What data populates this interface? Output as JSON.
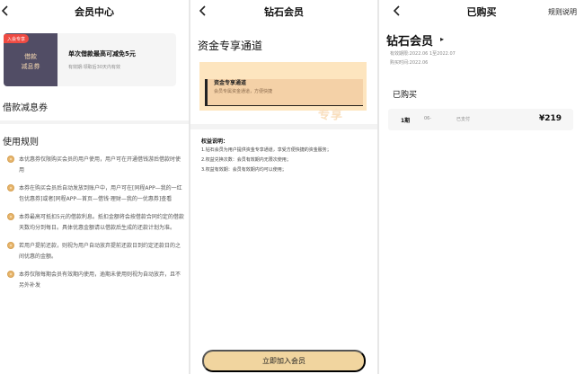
{
  "screens": [
    {
      "title": "会员中心",
      "coupon": {
        "badge": "入会专享",
        "name_line1": "借款",
        "name_line2": "减息券",
        "main": "单次借款最高可减免5元",
        "sub": "有效期:领取后30天内有效"
      },
      "section1": "借款减息券",
      "section2": "使用规则",
      "rules": [
        "本优惠券仅限购买会员的用户使用，用户可在开通借钱游后借款时使用",
        "本券在购买会员后自动发放到账户中，用户可在[同程APP—我的一红包优惠券]或者[同程APP—首页—借钱·理财—我的一优惠券]查看",
        "本券最高可抵扣5元的借款利息。抵扣金额将会按借款合同约定的借款天数均分到每日。具体优惠金额请以借款后生成的还款计划为准。",
        "若用户提前还款，则视为用户自动放弃提前还款日到约定还款日的之间优惠的金额。",
        "本券仅限每期会员有效期内使用，逾期未使用则视为自动放弃，且不另外补发"
      ]
    },
    {
      "title": "钻石会员",
      "head": "资金专享通道",
      "banner": {
        "title": "资金专享通道",
        "sub": "会员专属资金通道，方便快捷",
        "watermark": "专享"
      },
      "benefit_title": "权益说明：",
      "benefits": [
        "1.钻石会员为用户提供资金专享通道，享受方便快捷的资金服务；",
        "2.权益兑换次数：会员有效期内无限次使用；",
        "3.权益有效期：会员有效期内均可以使用；"
      ],
      "join_label": "立即加入会员"
    },
    {
      "title": "已购买",
      "right_link": "规则说明",
      "h1": "钻石会员",
      "arrow": "▸",
      "meta1": "有效期限:2022.06    1至2022.07",
      "meta2": "购买时间:2022.06",
      "bought_title": "已购买",
      "order": {
        "period": "1期",
        "date": "06-",
        "status": "已支付",
        "price": "¥219"
      }
    }
  ]
}
